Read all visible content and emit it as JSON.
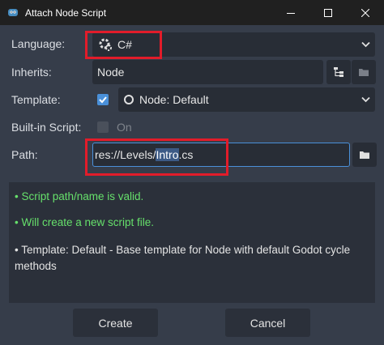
{
  "window": {
    "title": "Attach Node Script"
  },
  "form": {
    "language": {
      "label": "Language:",
      "value": "C#"
    },
    "inherits": {
      "label": "Inherits:",
      "value": "Node"
    },
    "template": {
      "label": "Template:",
      "value": "Node: Default",
      "checked": true
    },
    "builtin": {
      "label": "Built-in Script:",
      "value": "On",
      "checked": false
    },
    "path": {
      "label": "Path:",
      "prefix": "res://Levels/",
      "selected": "Intro",
      "suffix": ".cs"
    }
  },
  "messages": [
    {
      "text": "•  Script path/name is valid."
    },
    {
      "text": "•  Will create a new script file."
    },
    {
      "text": "•  Template: Default - Base template for Node with default Godot cycle methods"
    }
  ],
  "buttons": {
    "create": "Create",
    "cancel": "Cancel"
  },
  "colors": {
    "accent": "#4a90d9",
    "valid": "#66e06b",
    "highlight": "#e21c2a"
  }
}
